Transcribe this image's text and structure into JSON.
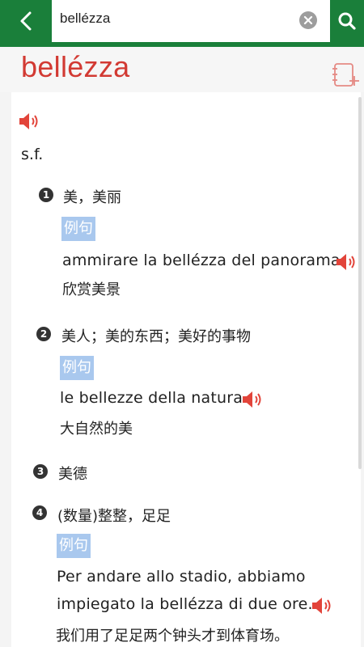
{
  "search": {
    "query": "bellézza"
  },
  "entry": {
    "headword": "bellézza",
    "pos": "s.f.",
    "senses": [
      {
        "num": "1",
        "meaning": "美，美丽",
        "example_label": "例句",
        "example_it": "ammirare la bellézza del panorama",
        "example_cn": "欣赏美景"
      },
      {
        "num": "2",
        "meaning": "美人；美的东西；美好的事物",
        "example_label": "例句",
        "example_it": "le bellezze della natura",
        "example_cn": "大自然的美"
      },
      {
        "num": "3",
        "meaning": "美德"
      },
      {
        "num": "4",
        "meaning": "(数量)整整，足足",
        "example_label": "例句",
        "example_it_line1": "Per andare allo stadio, abbiamo",
        "example_it_line2": "impiegato la bellézza di due ore.",
        "example_cn": "我们用了足足两个钟头才到体育场。"
      }
    ]
  },
  "colors": {
    "topbar": "#1a7f3a",
    "headword": "#d23a33",
    "example_badge": "#a9c8ee",
    "speaker": "#e2443a"
  }
}
